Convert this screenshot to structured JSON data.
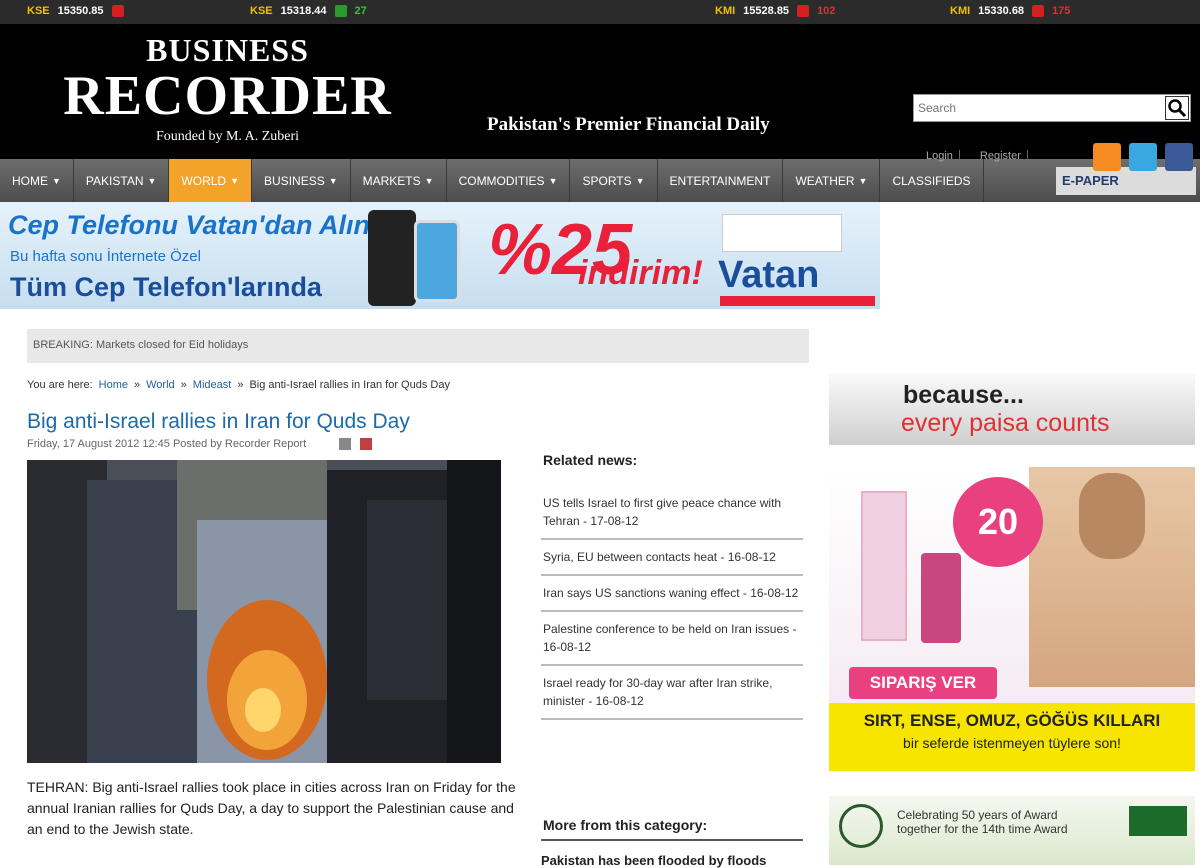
{
  "ticker": [
    {
      "label": "KSE",
      "value": "15350.85",
      "dir": "down",
      "change": ""
    },
    {
      "label": "KSE",
      "value": "15318.44",
      "dir": "up",
      "change": "27"
    },
    {
      "label": "KMI",
      "value": "15528.85",
      "dir": "down",
      "change": "102"
    },
    {
      "label": "KMI",
      "value": "15330.68",
      "dir": "down",
      "change": "175"
    }
  ],
  "header": {
    "logo_line1": "BUSINESS",
    "logo_line2": "RECORDER",
    "logo_line3": "Founded by M. A. Zuberi",
    "tagline": "Pakistan's Premier Financial Daily",
    "search_placeholder": "Search",
    "login_label": "Login",
    "register_label": "Register"
  },
  "nav": {
    "items": [
      {
        "label": "HOME",
        "arrow": true
      },
      {
        "label": "PAKISTAN",
        "arrow": true
      },
      {
        "label": "WORLD",
        "arrow": true,
        "active": true
      },
      {
        "label": "BUSINESS",
        "arrow": true
      },
      {
        "label": "MARKETS",
        "arrow": true
      },
      {
        "label": "COMMODITIES",
        "arrow": true
      },
      {
        "label": "SPORTS",
        "arrow": true
      },
      {
        "label": "ENTERTAINMENT",
        "arrow": false
      },
      {
        "label": "WEATHER",
        "arrow": true
      },
      {
        "label": "CLASSIFIEDS",
        "arrow": false
      }
    ],
    "epaper_label": "E-PAPER"
  },
  "banner": {
    "line1": "Cep Telefonu Vatan'dan Alınır",
    "line2": "Bu hafta sonu İnternete Özel",
    "line3": "Tüm Cep Telefon'larında",
    "percent": "%25",
    "indirim": "indirim!",
    "brand": "Vatan"
  },
  "breaking": {
    "label": "BREAKING:",
    "text": "Markets closed for Eid holidays"
  },
  "breadcrumb": {
    "prefix": "You are here:",
    "items": [
      "Home",
      "World",
      "Mideast"
    ],
    "current": "Big anti-Israel rallies in Iran for Quds Day"
  },
  "article": {
    "title": "Big anti-Israel rallies in Iran for Quds Day",
    "meta": "Friday, 17 August 2012 12:45  Posted by Recorder Report",
    "body": "TEHRAN: Big anti-Israel rallies took place in cities across Iran on Friday for the annual Iranian rallies for Quds Day, a day to support the Palestinian cause and an end to the Jewish state."
  },
  "related": {
    "heading": "Related news:",
    "items": [
      "US tells Israel to first give peace chance with Tehran - 17-08-12",
      "Syria, EU between contacts heat - 16-08-12",
      "Iran says US sanctions waning effect - 16-08-12",
      "Palestine conference to be held on Iran issues - 16-08-12",
      "Israel ready for 30-day war after Iran strike, minister - 16-08-12"
    ]
  },
  "more_category": {
    "heading": "More from this category:",
    "first_item": "Pakistan has been flooded by floods"
  },
  "ads": {
    "paisa_line1": "because...",
    "paisa_line2": "every paisa counts",
    "cream_discount": "20",
    "cream_order": "SIPARIŞ VER",
    "cream_line1": "SIRT, ENSE, OMUZ, GÖĞÜS KILLARI",
    "cream_line2": "bir seferde istenmeyen tüylere son!",
    "green_line1": "Celebrating 50 years of Award",
    "green_line2": "together for the 14th time Award"
  },
  "colors": {
    "nav_active": "#f4a32a",
    "title_blue": "#1e6aa8",
    "banner_red": "#e8203a"
  }
}
